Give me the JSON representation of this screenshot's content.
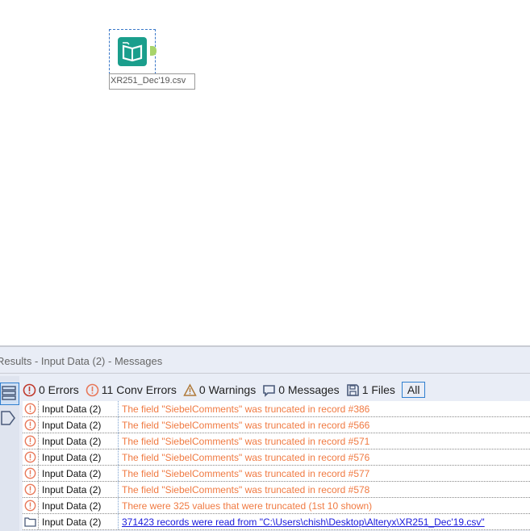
{
  "canvas": {
    "tool": {
      "label": "XR251_Dec'19.csv",
      "icon": "book-icon",
      "color": "#1a9e8c"
    }
  },
  "panel": {
    "title": "Results - Input Data (2) - Messages",
    "filters": {
      "errors": "0 Errors",
      "conv_errors": "11 Conv Errors",
      "warnings": "0 Warnings",
      "messages": "0 Messages",
      "files": "1 Files",
      "all": "All"
    },
    "rows": [
      {
        "tool": "Input Data (2)",
        "message": "The field \"SiebelComments\" was truncated in record #386"
      },
      {
        "tool": "Input Data (2)",
        "message": "The field \"SiebelComments\" was truncated in record #566"
      },
      {
        "tool": "Input Data (2)",
        "message": "The field \"SiebelComments\" was truncated in record #571"
      },
      {
        "tool": "Input Data (2)",
        "message": "The field \"SiebelComments\" was truncated in record #576"
      },
      {
        "tool": "Input Data (2)",
        "message": "The field \"SiebelComments\" was truncated in record #577"
      },
      {
        "tool": "Input Data (2)",
        "message": "The field \"SiebelComments\" was truncated in record #578"
      },
      {
        "tool": "Input Data (2)",
        "message": "There were 325 values that were truncated (1st 10 shown)"
      },
      {
        "tool": "Input Data (2)",
        "message": "371423 records were read from \"C:\\Users\\chish\\Desktop\\Alteryx\\XR251_Dec'19.csv\""
      }
    ]
  }
}
